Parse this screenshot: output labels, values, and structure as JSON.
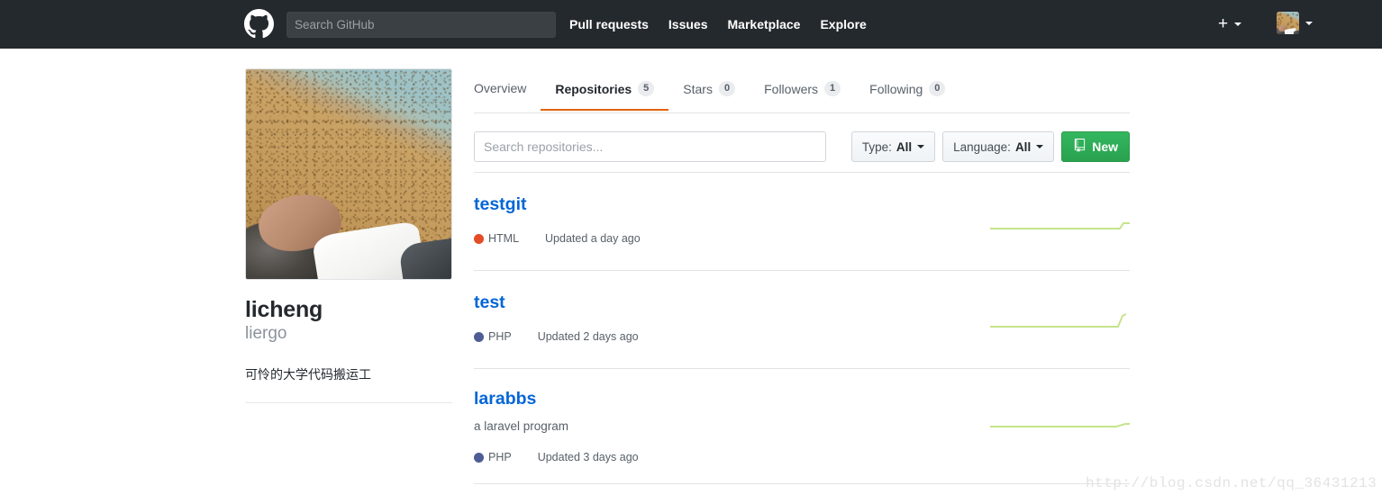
{
  "header": {
    "logo_icon": "github-mark-icon",
    "search": {
      "placeholder": "Search GitHub",
      "value": ""
    },
    "nav": [
      {
        "label": "Pull requests"
      },
      {
        "label": "Issues"
      },
      {
        "label": "Marketplace"
      },
      {
        "label": "Explore"
      }
    ],
    "create_new_icon": "plus-icon",
    "create_new_caret_icon": "chevron-down-icon",
    "avatar_icon": "user-avatar",
    "avatar_caret_icon": "chevron-down-icon",
    "background_color": "#24292e"
  },
  "profile": {
    "avatar_icon": "user-avatar-large",
    "name": "licheng",
    "login": "liergo",
    "bio": "可怜的大学代码搬运工"
  },
  "tabs": [
    {
      "label": "Overview",
      "count": null,
      "active": false
    },
    {
      "label": "Repositories",
      "count": "5",
      "active": true
    },
    {
      "label": "Stars",
      "count": "0",
      "active": false
    },
    {
      "label": "Followers",
      "count": "1",
      "active": false
    },
    {
      "label": "Following",
      "count": "0",
      "active": false
    }
  ],
  "filters": {
    "search_placeholder": "Search repositories...",
    "search_value": "",
    "type": {
      "label": "Type:",
      "value": "All",
      "caret_icon": "chevron-down-icon"
    },
    "language": {
      "label": "Language:",
      "value": "All",
      "caret_icon": "chevron-down-icon"
    },
    "new_button": {
      "label": "New",
      "icon": "repo-book-icon",
      "color": "#2ea44f"
    }
  },
  "repositories": [
    {
      "name": "testgit",
      "description": "",
      "language": "HTML",
      "language_color": "#e34c26",
      "updated": "Updated a day ago",
      "sparkline": [
        0,
        0,
        0,
        0,
        0,
        0,
        0,
        0,
        0,
        0,
        0,
        0,
        0,
        0,
        0,
        0,
        0,
        0,
        0,
        0,
        0,
        0,
        0,
        0,
        0,
        0,
        0,
        0,
        1,
        1
      ]
    },
    {
      "name": "test",
      "description": "",
      "language": "PHP",
      "language_color": "#4F5D95",
      "updated": "Updated 2 days ago",
      "sparkline": [
        0,
        0,
        0,
        0,
        0,
        0,
        0,
        0,
        0,
        0,
        0,
        0,
        0,
        0,
        0,
        0,
        0,
        0,
        0,
        0,
        0,
        0,
        0,
        0,
        0,
        0,
        0,
        0,
        1,
        2
      ]
    },
    {
      "name": "larabbs",
      "description": "a laravel program",
      "language": "PHP",
      "language_color": "#4F5D95",
      "updated": "Updated 3 days ago",
      "sparkline": [
        0,
        0,
        0,
        0,
        0,
        0,
        0,
        0,
        0,
        0,
        0,
        0,
        0,
        0,
        0,
        0,
        0,
        0,
        0,
        0,
        0,
        0,
        0,
        0,
        0,
        0,
        0,
        0,
        0,
        1
      ]
    }
  ],
  "accent": {
    "active_tab_underline": "#e36209",
    "link_blue": "#0366d6",
    "sparkline_green": "#c6e48b"
  },
  "watermark": "http://blog.csdn.net/qq_36431213"
}
